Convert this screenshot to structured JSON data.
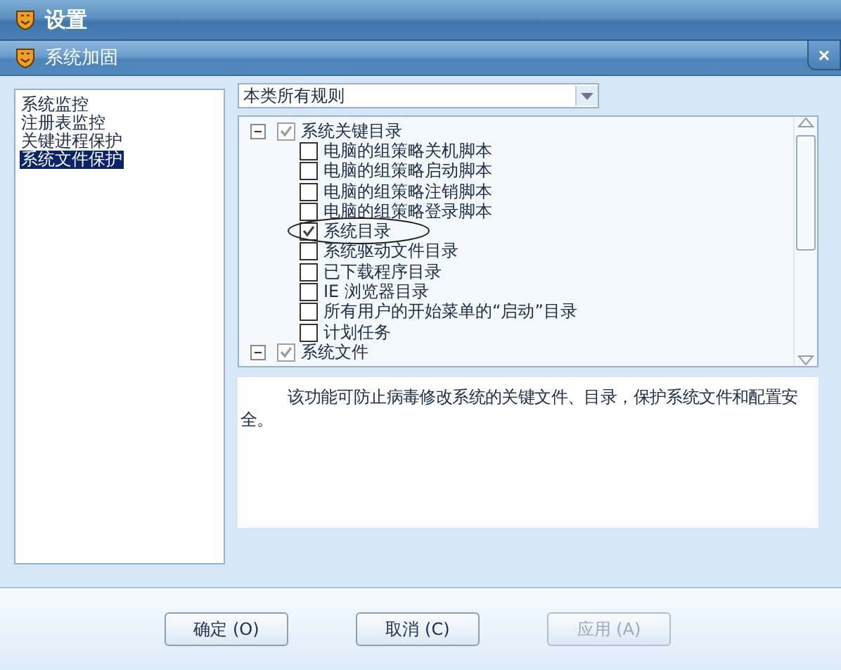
{
  "window": {
    "title": "设置"
  },
  "dialog": {
    "title": "系统加固",
    "close": "×"
  },
  "sidebar": {
    "items": [
      {
        "label": "系统监控",
        "selected": false
      },
      {
        "label": "注册表监控",
        "selected": false
      },
      {
        "label": "关键进程保护",
        "selected": false
      },
      {
        "label": "系统文件保护",
        "selected": true
      }
    ]
  },
  "filter": {
    "value": "本类所有规则"
  },
  "tree": [
    {
      "label": "系统关键目录",
      "checked": true,
      "expanded": true,
      "children": [
        {
          "label": "电脑的组策略关机脚本",
          "checked": false
        },
        {
          "label": "电脑的组策略启动脚本",
          "checked": false
        },
        {
          "label": "电脑的组策略注销脚本",
          "checked": false
        },
        {
          "label": "电脑的组策略登录脚本",
          "checked": false
        },
        {
          "label": "系统目录",
          "checked": true,
          "circled": true
        },
        {
          "label": "系统驱动文件目录",
          "checked": false
        },
        {
          "label": "已下载程序目录",
          "checked": false
        },
        {
          "label": "IE 浏览器目录",
          "checked": false
        },
        {
          "label": "所有用户的开始菜单的“启动”目录",
          "checked": false
        },
        {
          "label": "计划任务",
          "checked": false
        }
      ]
    },
    {
      "label": "系统文件",
      "checked": true,
      "expanded": true
    }
  ],
  "description": "该功能可防止病毒修改系统的关键文件、目录，保护系统文件和配置安全。",
  "buttons": [
    {
      "label": "确定 (O)",
      "disabled": false
    },
    {
      "label": "取消 (C)",
      "disabled": false
    },
    {
      "label": "应用 (A)",
      "disabled": true
    }
  ]
}
